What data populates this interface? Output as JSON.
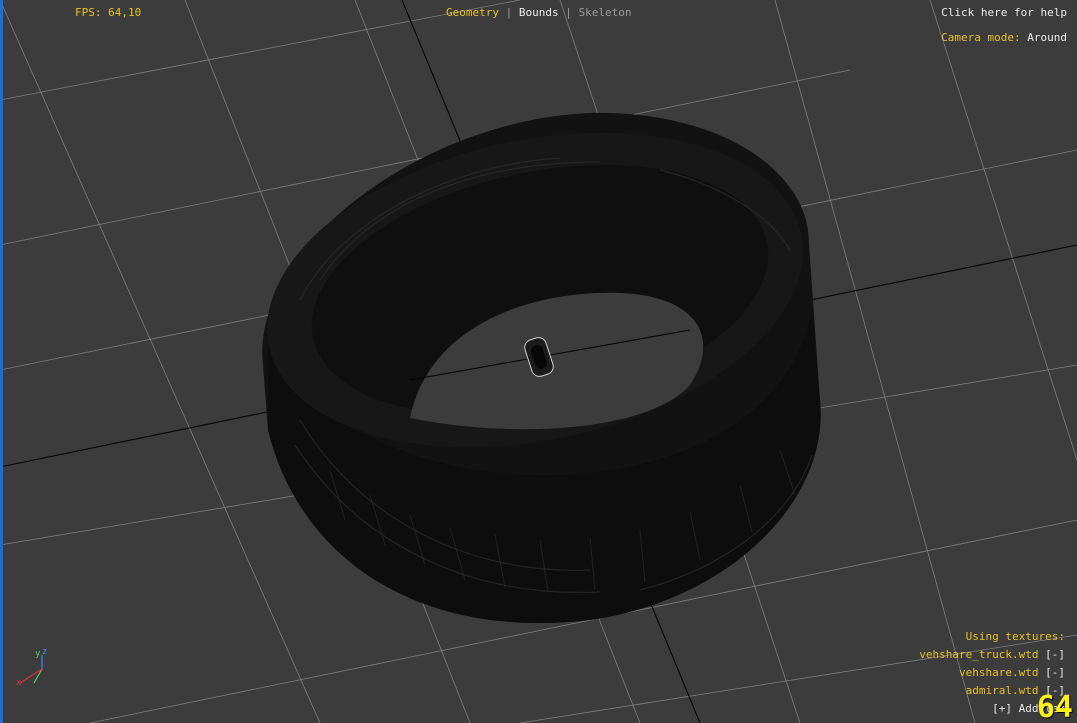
{
  "hud": {
    "fps": "FPS: 64,10",
    "tabs": [
      "Geometry",
      "Bounds",
      "Skeleton"
    ],
    "help": "Click here for help",
    "camera_label": "Camera mode:",
    "camera_value": "Around",
    "fps_counter": "64"
  },
  "textures": {
    "heading": "Using textures:",
    "items": [
      {
        "name": "vehshare_truck.wtd",
        "remove": "[-]"
      },
      {
        "name": "vehshare.wtd",
        "remove": "[-]"
      },
      {
        "name": "admiral.wtd",
        "remove": "[-]"
      }
    ],
    "add_label": "[+] Add tex"
  },
  "axis": {
    "x": "x",
    "y": "y",
    "z": "z"
  },
  "colors": {
    "background": "#3c3c3c",
    "grid": "#b8b8b8",
    "tire": "#121212",
    "accent": "#e6c229",
    "edge": "#1a6fd6"
  }
}
